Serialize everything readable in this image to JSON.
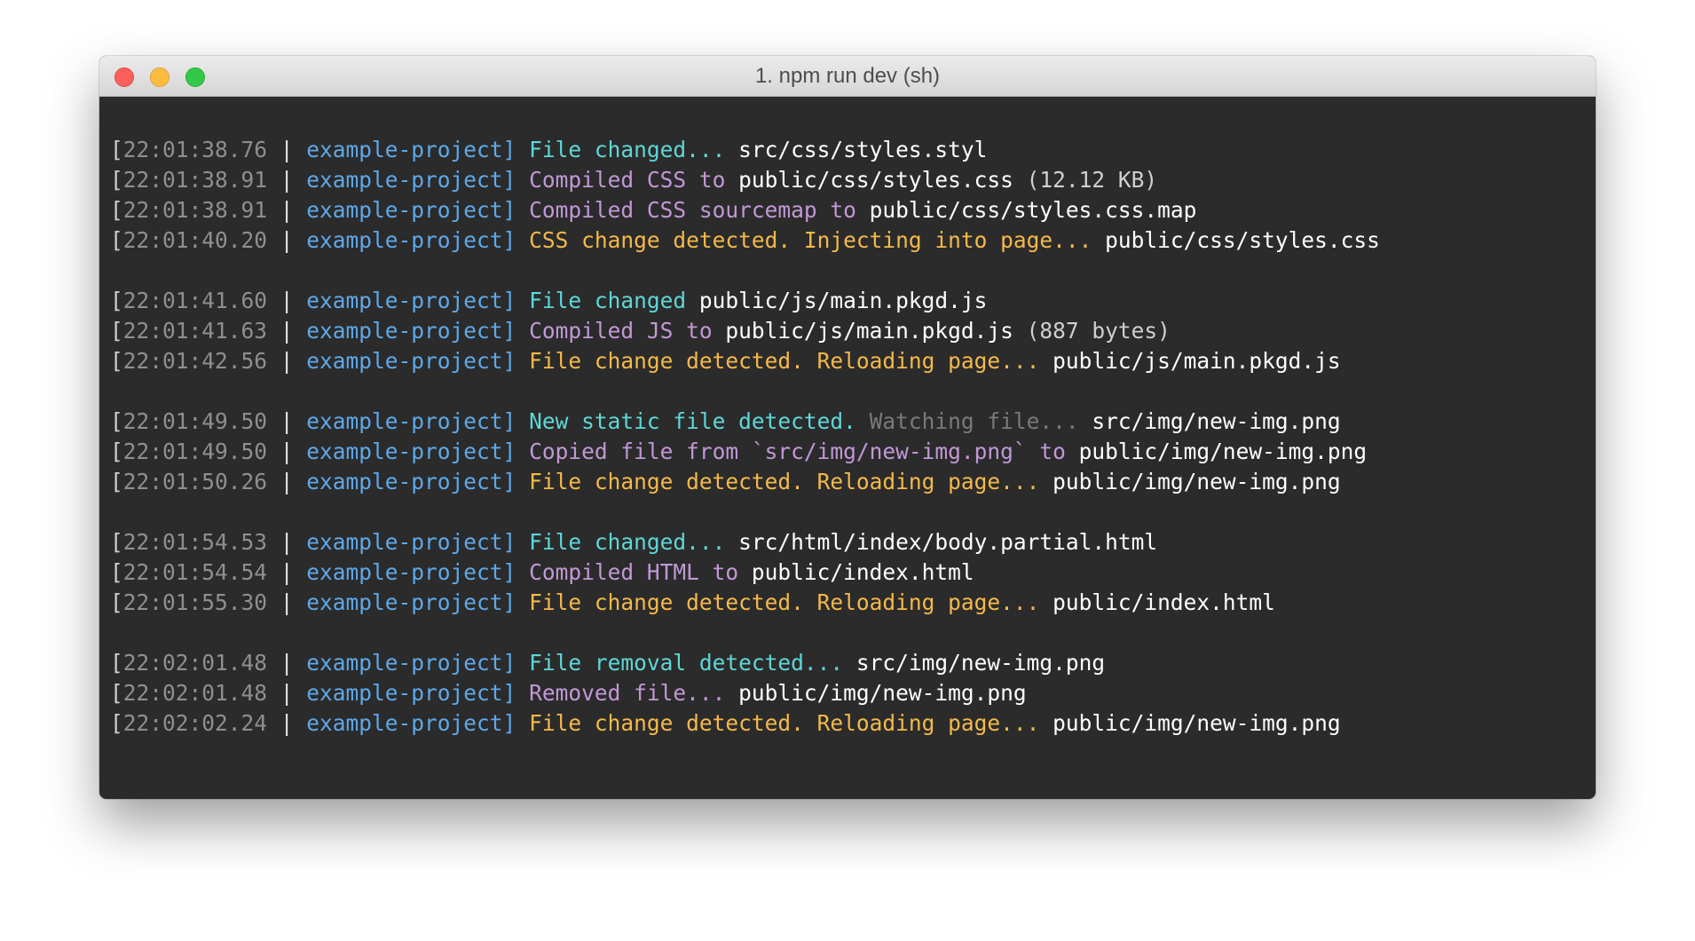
{
  "window": {
    "title": "1. npm run dev (sh)",
    "traffic_lights": [
      "close",
      "minimize",
      "maximize"
    ]
  },
  "colors": {
    "terminal_bg": "#2b2b2b",
    "timestamp": "#8f8f8f",
    "project": "#5fa8e8",
    "cyan": "#5fd7d7",
    "purple": "#c198d6",
    "yellow": "#f5b94a",
    "path": "#ffffff"
  },
  "project": "example-project",
  "log_groups": [
    [
      {
        "ts": "22:01:38.76",
        "segments": [
          {
            "text": "File changed... ",
            "color": "cyan"
          },
          {
            "text": "src/css/styles.styl",
            "color": "white"
          }
        ]
      },
      {
        "ts": "22:01:38.91",
        "segments": [
          {
            "text": "Compiled CSS to ",
            "color": "purple"
          },
          {
            "text": "public/css/styles.css",
            "color": "white"
          },
          {
            "text": " (12.12 KB)",
            "color": "paren"
          }
        ]
      },
      {
        "ts": "22:01:38.91",
        "segments": [
          {
            "text": "Compiled CSS sourcemap to ",
            "color": "purple"
          },
          {
            "text": "public/css/styles.css.map",
            "color": "white"
          }
        ]
      },
      {
        "ts": "22:01:40.20",
        "segments": [
          {
            "text": "CSS change detected. Injecting into page... ",
            "color": "yellow"
          },
          {
            "text": "public/css/styles.css",
            "color": "white"
          }
        ]
      }
    ],
    [
      {
        "ts": "22:01:41.60",
        "segments": [
          {
            "text": "File changed ",
            "color": "cyan"
          },
          {
            "text": "public/js/main.pkgd.js",
            "color": "white"
          }
        ]
      },
      {
        "ts": "22:01:41.63",
        "segments": [
          {
            "text": "Compiled JS to ",
            "color": "purple"
          },
          {
            "text": "public/js/main.pkgd.js",
            "color": "white"
          },
          {
            "text": " (887 bytes)",
            "color": "paren"
          }
        ]
      },
      {
        "ts": "22:01:42.56",
        "segments": [
          {
            "text": "File change detected. Reloading page... ",
            "color": "yellow"
          },
          {
            "text": "public/js/main.pkgd.js",
            "color": "white"
          }
        ]
      }
    ],
    [
      {
        "ts": "22:01:49.50",
        "segments": [
          {
            "text": "New static file detected. ",
            "color": "cyan"
          },
          {
            "text": "Watching file... ",
            "color": "dim"
          },
          {
            "text": "src/img/new-img.png",
            "color": "white"
          }
        ]
      },
      {
        "ts": "22:01:49.50",
        "segments": [
          {
            "text": "Copied file from `src/img/new-img.png` to ",
            "color": "purple"
          },
          {
            "text": "public/img/new-img.png",
            "color": "white"
          }
        ]
      },
      {
        "ts": "22:01:50.26",
        "segments": [
          {
            "text": "File change detected. Reloading page... ",
            "color": "yellow"
          },
          {
            "text": "public/img/new-img.png",
            "color": "white"
          }
        ]
      }
    ],
    [
      {
        "ts": "22:01:54.53",
        "segments": [
          {
            "text": "File changed... ",
            "color": "cyan"
          },
          {
            "text": "src/html/index/body.partial.html",
            "color": "white"
          }
        ]
      },
      {
        "ts": "22:01:54.54",
        "segments": [
          {
            "text": "Compiled HTML to ",
            "color": "purple"
          },
          {
            "text": "public/index.html",
            "color": "white"
          }
        ]
      },
      {
        "ts": "22:01:55.30",
        "segments": [
          {
            "text": "File change detected. Reloading page... ",
            "color": "yellow"
          },
          {
            "text": "public/index.html",
            "color": "white"
          }
        ]
      }
    ],
    [
      {
        "ts": "22:02:01.48",
        "segments": [
          {
            "text": "File removal detected... ",
            "color": "cyan"
          },
          {
            "text": "src/img/new-img.png",
            "color": "white"
          }
        ]
      },
      {
        "ts": "22:02:01.48",
        "segments": [
          {
            "text": "Removed file... ",
            "color": "purple"
          },
          {
            "text": "public/img/new-img.png",
            "color": "white"
          }
        ]
      },
      {
        "ts": "22:02:02.24",
        "segments": [
          {
            "text": "File change detected. Reloading page... ",
            "color": "yellow"
          },
          {
            "text": "public/img/new-img.png",
            "color": "white"
          }
        ]
      }
    ]
  ]
}
